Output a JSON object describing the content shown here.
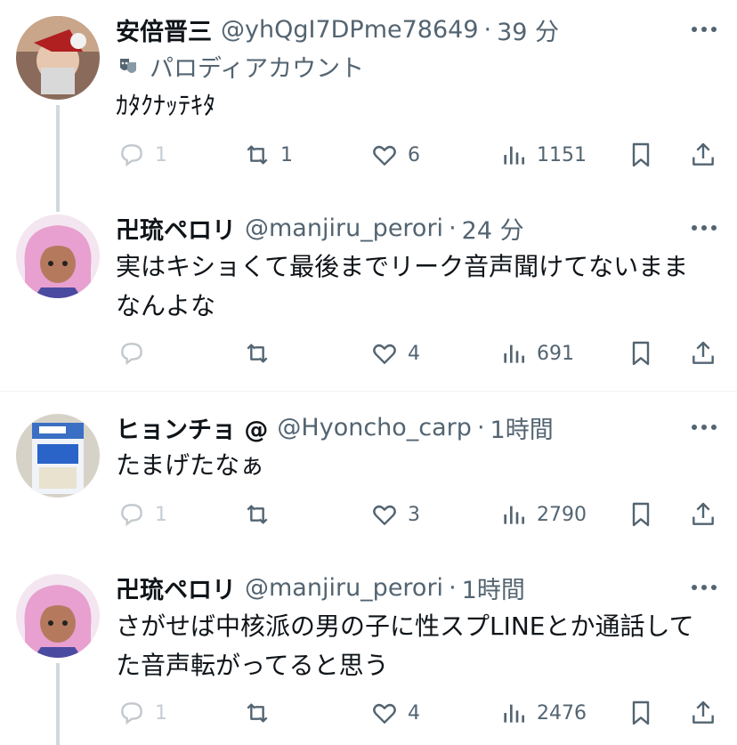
{
  "tweets": [
    {
      "name": "安倍晋三",
      "handle": "@yhQgI7DPme78649",
      "time": "39 分",
      "parody_label": "パロディアカウント",
      "text": "ｶﾀｸﾅｯﾃｷﾀ",
      "replies": "1",
      "retweets": "1",
      "likes": "6",
      "views": "1151"
    },
    {
      "name": "卍琉ペロリ",
      "handle": "@manjiru_perori",
      "time": "24 分",
      "text": "実はキショくて最後までリーク音声聞けてないままなんよな",
      "replies": "",
      "retweets": "",
      "likes": "4",
      "views": "691"
    },
    {
      "name": "ヒョンチョ @",
      "handle": "@Hyoncho_carp",
      "time": "1時間",
      "text": "たまげたなぁ",
      "replies": "1",
      "retweets": "",
      "likes": "3",
      "views": "2790"
    },
    {
      "name": "卍琉ペロリ",
      "handle": "@manjiru_perori",
      "time": "1時間",
      "text": "さがせば中核派の男の子に性スプLINEとか通話してた音声転がってると思う",
      "replies": "1",
      "retweets": "",
      "likes": "4",
      "views": "2476"
    }
  ],
  "separator": "·",
  "colors": {
    "text": "#0f1419",
    "secondary": "#536471",
    "divider": "#eff3f4",
    "thread_line": "#cfd9de"
  },
  "icons": {
    "reply": "speech-bubble-icon",
    "retweet": "retweet-arrows-icon",
    "like": "heart-icon",
    "views": "bar-chart-icon",
    "bookmark": "bookmark-icon",
    "share": "share-upload-icon",
    "more": "ellipsis-icon",
    "parody": "theater-mask-icon"
  }
}
